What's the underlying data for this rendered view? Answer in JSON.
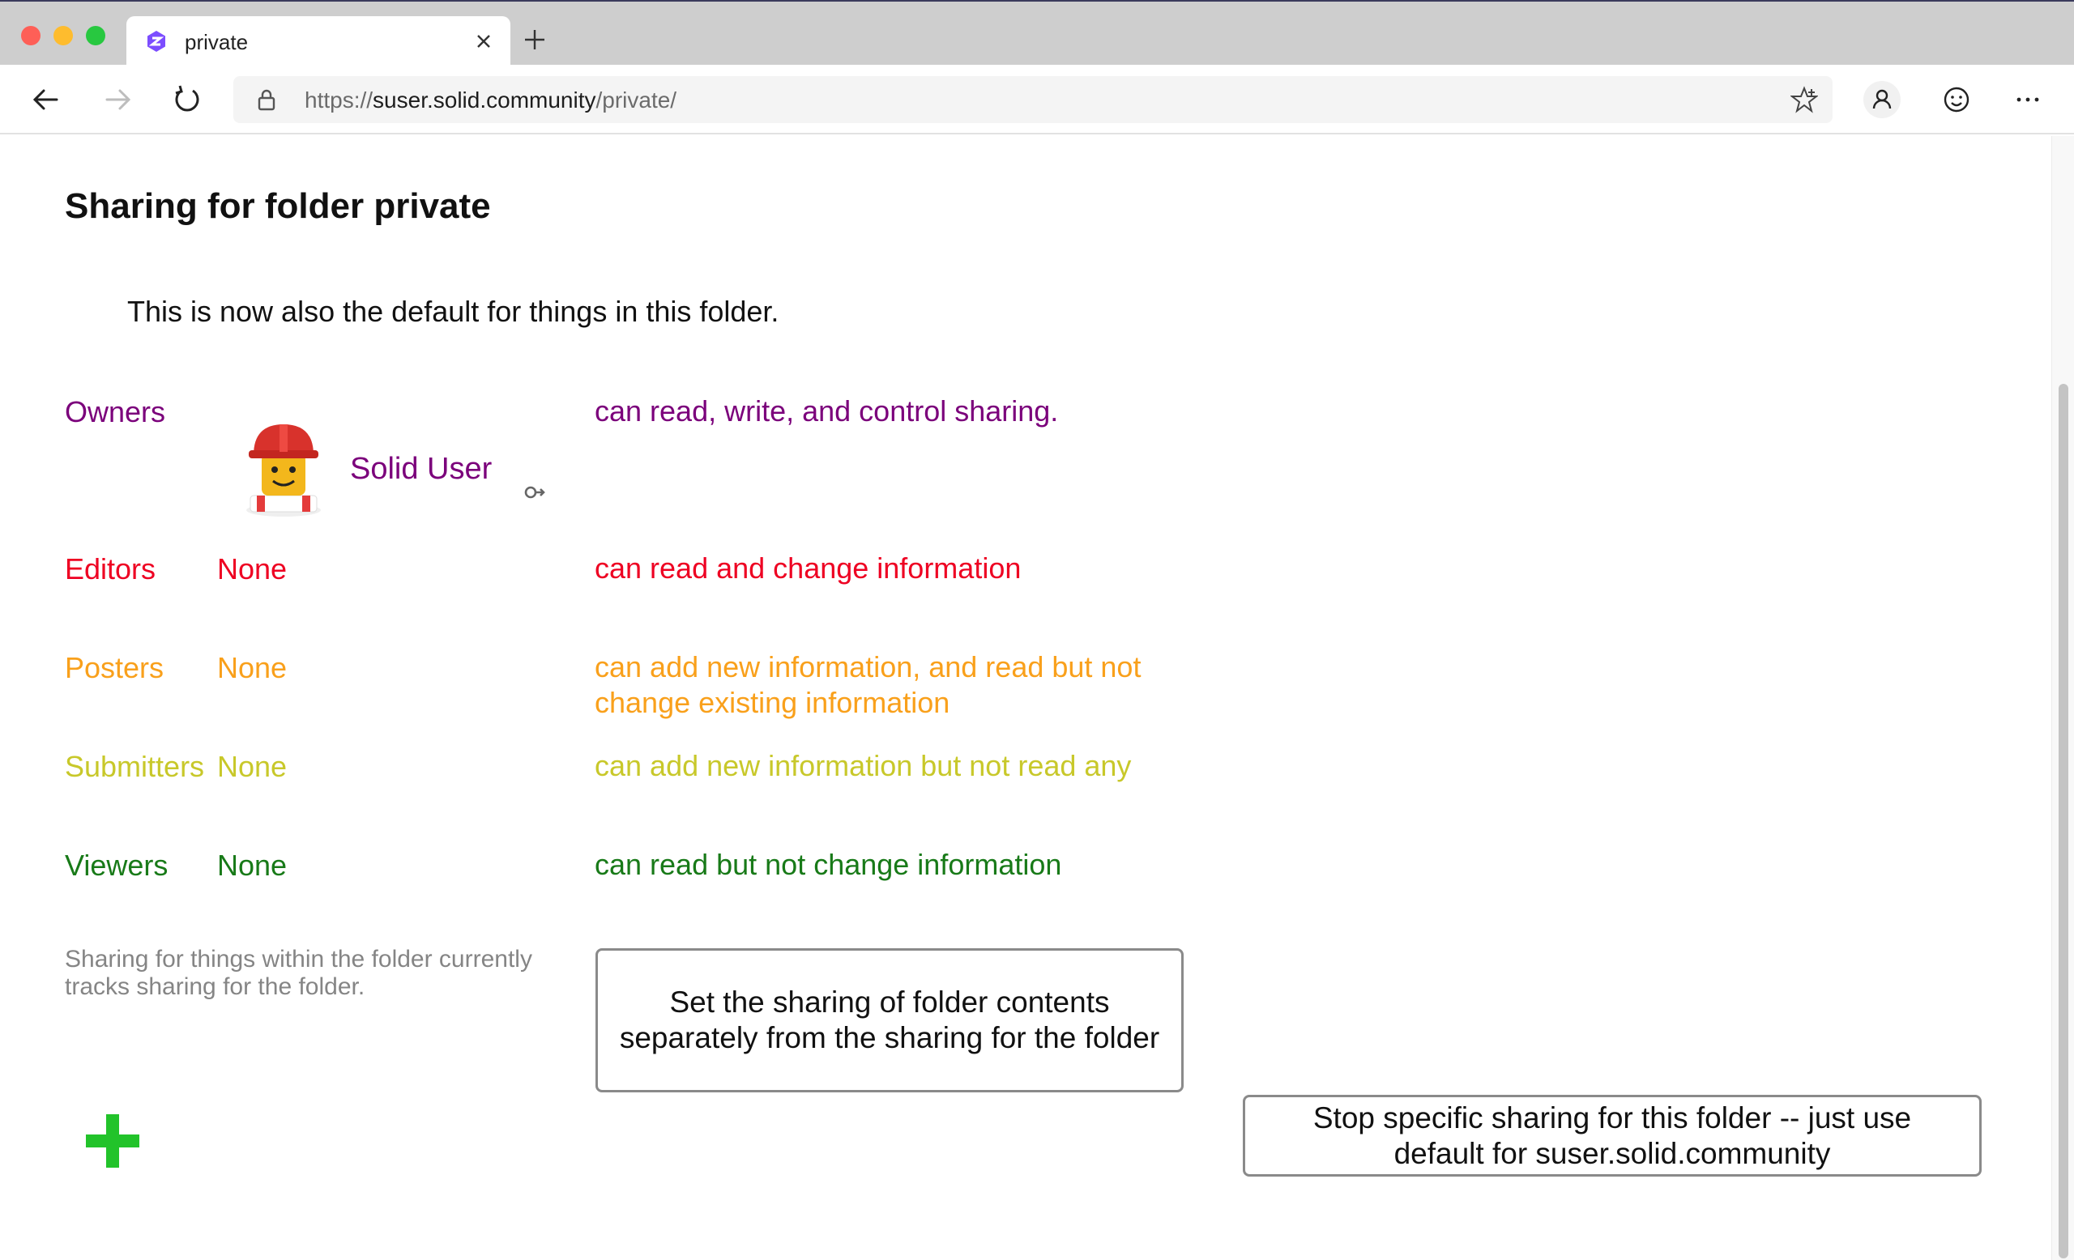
{
  "browser": {
    "tab_title": "private",
    "url_scheme": "https://",
    "url_host": "suser.solid.community",
    "url_path": "/private/"
  },
  "page": {
    "title": "Sharing for folder private",
    "default_note": "This is now also the default for things in this folder."
  },
  "roles": {
    "owners": {
      "label": "Owners",
      "description": "can read, write, and control sharing.",
      "agent_name": "Solid User",
      "color": "#7b007b"
    },
    "editors": {
      "label": "Editors",
      "agent": "None",
      "description": "can read and change information",
      "color": "#ee0022"
    },
    "posters": {
      "label": "Posters",
      "agent": "None",
      "description_line1": "can add new information, and read but not",
      "description_line2": "change existing information",
      "color": "#f9a01b"
    },
    "submitters": {
      "label": "Submitters",
      "agent": "None",
      "description": "can add new information but not read any",
      "color": "#c8c82a"
    },
    "viewers": {
      "label": "Viewers",
      "agent": "None",
      "description": "can read but not change information",
      "color": "#187a18"
    }
  },
  "contents_note": "Sharing for things within the folder currently tracks sharing for the folder.",
  "buttons": {
    "set_contents_line1": "Set the sharing of folder contents",
    "set_contents_line2": "separately from the sharing for the folder",
    "stop_specific_line1": "Stop specific sharing for this folder -- just use",
    "stop_specific_line2": "default for suser.solid.community"
  },
  "icons": {
    "add": "green-plus-icon",
    "avatar": "lego-builder-avatar",
    "link": "link-arrow-icon"
  }
}
